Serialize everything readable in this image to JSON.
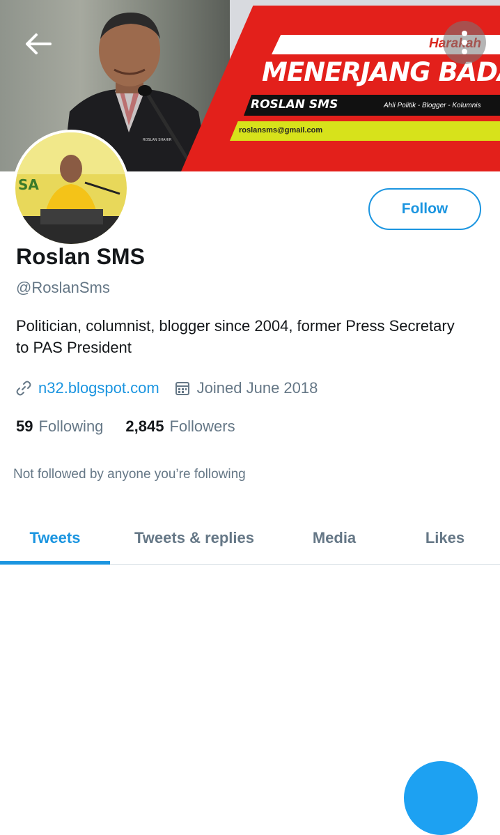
{
  "banner": {
    "headline": "MENERJANG BADAI",
    "name": "ROSLAN SMS",
    "roles": "Ahli Politik - Blogger - Kolumnis",
    "email": "roslansms@gmail.com",
    "logo": "Harakah",
    "accent_red": "#e3201b",
    "accent_yellow": "#d7e21b"
  },
  "header": {
    "back_icon": "arrow-left-icon",
    "more_icon": "more-vertical-icon"
  },
  "profile": {
    "display_name": "Roslan SMS",
    "handle": "@RoslanSms",
    "bio": "Politician, columnist, blogger since 2004, former Press Secretary to PAS President",
    "website": "n32.blogspot.com",
    "joined": "Joined June 2018",
    "following_count": "59",
    "following_label": "Following",
    "followers_count": "2,845",
    "followers_label": "Followers",
    "not_followed_text": "Not followed by anyone you’re following"
  },
  "follow_button": {
    "label": "Follow"
  },
  "tabs": [
    {
      "label": "Tweets",
      "active": true
    },
    {
      "label": "Tweets & replies",
      "active": false
    },
    {
      "label": "Media",
      "active": false
    },
    {
      "label": "Likes",
      "active": false
    }
  ],
  "colors": {
    "accent": "#1b95e0",
    "secondary_text": "#657786",
    "primary_text": "#14171a",
    "fab": "#1da1f2"
  }
}
